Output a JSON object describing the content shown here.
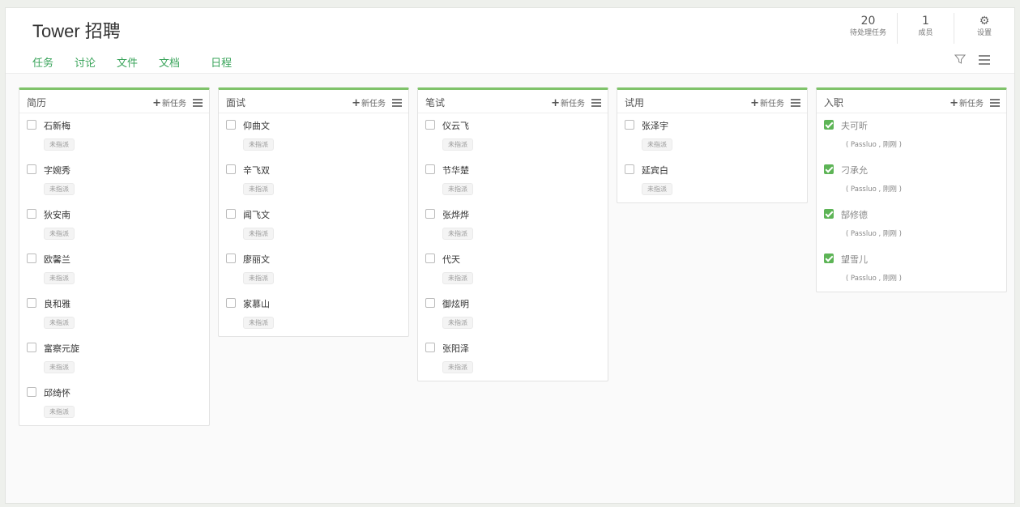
{
  "app": {
    "title": "Tower 招聘",
    "nav": [
      "任务",
      "讨论",
      "文件",
      "文档",
      "日程"
    ],
    "stats": [
      {
        "num": "20",
        "label": "待处理任务"
      },
      {
        "num": "1",
        "label": "成员"
      },
      {
        "num": "",
        "label": "设置"
      }
    ]
  },
  "board": {
    "add_label": "新任务",
    "columns": [
      {
        "name": "简历",
        "tasks": [
          {
            "name": "石新梅",
            "tag": "未指派"
          },
          {
            "name": "字婉秀",
            "tag": "未指派"
          },
          {
            "name": "狄安南",
            "tag": "未指派"
          },
          {
            "name": "欧馨兰",
            "tag": "未指派"
          },
          {
            "name": "良和雅",
            "tag": "未指派"
          },
          {
            "name": "富察元旋",
            "tag": "未指派"
          },
          {
            "name": "邱绮怀",
            "tag": "未指派"
          }
        ]
      },
      {
        "name": "面试",
        "tasks": [
          {
            "name": "仰曲文",
            "tag": "未指派"
          },
          {
            "name": "辛飞双",
            "tag": "未指派"
          },
          {
            "name": "闻飞文",
            "tag": "未指派"
          },
          {
            "name": "廖丽文",
            "tag": "未指派"
          },
          {
            "name": "家慕山",
            "tag": "未指派"
          }
        ]
      },
      {
        "name": "笔试",
        "tasks": [
          {
            "name": "仪云飞",
            "tag": "未指派"
          },
          {
            "name": "节华楚",
            "tag": "未指派"
          },
          {
            "name": "张烨烨",
            "tag": "未指派"
          },
          {
            "name": "代天",
            "tag": "未指派"
          },
          {
            "name": "御炫明",
            "tag": "未指派"
          },
          {
            "name": "张阳泽",
            "tag": "未指派"
          }
        ]
      },
      {
        "name": "试用",
        "tasks": [
          {
            "name": "张泽宇",
            "tag": "未指派"
          },
          {
            "name": "延宾白",
            "tag": "未指派"
          }
        ]
      },
      {
        "name": "入职",
        "tasks": [
          {
            "name": "夫可昕",
            "note": "( Passluo , 刚刚 )",
            "done": true
          },
          {
            "name": "刁承允",
            "note": "( Passluo , 刚刚 )",
            "done": true
          },
          {
            "name": "郜修德",
            "note": "( Passluo , 刚刚 )",
            "done": true
          },
          {
            "name": "望雪儿",
            "note": "( Passluo , 刚刚 )",
            "done": true
          }
        ]
      }
    ]
  },
  "colors": {
    "accent": "#3aa45b",
    "column_border": "#7fc36a",
    "check": "#5db456"
  },
  "icons": [
    "gear-icon",
    "filter-icon",
    "menu-icon",
    "plus-icon",
    "checkbox-icon"
  ]
}
